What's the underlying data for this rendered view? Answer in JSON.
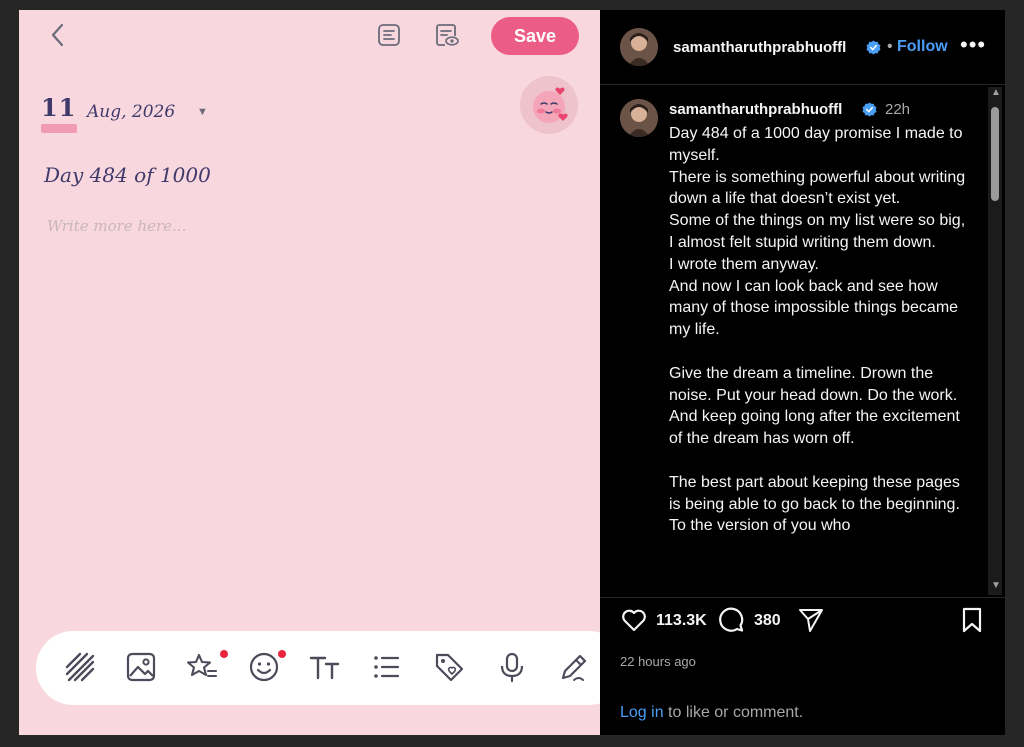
{
  "journal": {
    "save_label": "Save",
    "date_day": "11",
    "date_month": "Aug, 2026",
    "title": "Day 484 of 1000",
    "placeholder": "Write more here...",
    "accent_color": "#ec5d86",
    "background_color": "#f8d7df",
    "toolbar_icons": [
      "stripes-icon",
      "image-icon",
      "sticker-star-icon",
      "emoji-icon",
      "text-format-icon",
      "list-icon",
      "tag-icon",
      "microphone-icon",
      "pen-icon"
    ]
  },
  "instagram": {
    "username": "samantharuthprabhuoffl",
    "follow_label": "Follow",
    "separator": "•",
    "more_label": "•••",
    "post_age": "22h",
    "caption_lines": [
      "Day 484 of a 1000 day promise I made to myself.",
      "There is something powerful about writing down a life that doesn’t exist yet.",
      "Some of the things on my list were so big, I almost felt stupid writing them down.",
      "I wrote them anyway.",
      "And now I can look back and see how many of those impossible things became my life.",
      "",
      "Give the dream a timeline. Drown the noise. Put your head down. Do the work.",
      "And keep going long after the excitement of the dream has worn off.",
      "",
      "The best part about keeping these pages is being able to go back to the beginning. To the version of you who"
    ],
    "likes": "113.3K",
    "comments": "380",
    "time_ago": "22 hours ago",
    "login_link": "Log in",
    "login_text": " to like or comment.",
    "link_color": "#4a9ef5"
  }
}
